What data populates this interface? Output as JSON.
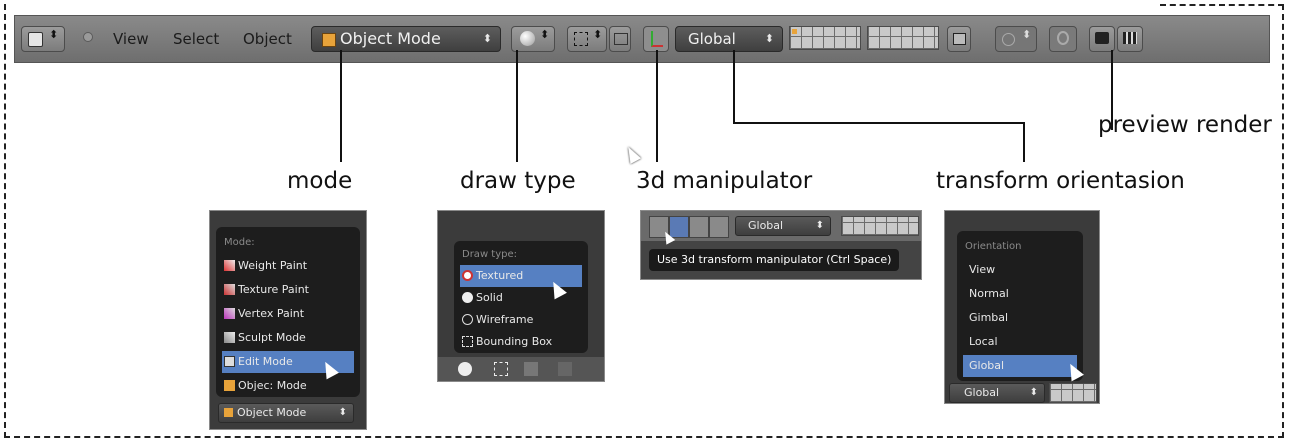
{
  "toolbar": {
    "menus": [
      "View",
      "Select",
      "Object"
    ],
    "mode_select": "Object Mode",
    "orientation_select": "Global"
  },
  "callouts": {
    "mode": "mode",
    "draw_type": "draw type",
    "manipulator": "3d manipulator",
    "orientation": "transform orientasion",
    "preview": "preview render"
  },
  "mode_menu": {
    "header": "Mode:",
    "items": [
      "Weight Paint",
      "Texture Paint",
      "Vertex Paint",
      "Sculpt Mode",
      "Edit Mode",
      "Objec: Mode"
    ],
    "selected_index": 4,
    "current": "Object Mode"
  },
  "draw_menu": {
    "header": "Draw type:",
    "items": [
      "Textured",
      "Solid",
      "Wireframe",
      "Bounding Box"
    ],
    "selected_index": 0
  },
  "manipulator_panel": {
    "select_value": "Global",
    "tooltip": "Use 3d transform manipulator (Ctrl Space)"
  },
  "orientation_menu": {
    "header": "Orientation",
    "items": [
      "View",
      "Normal",
      "Gimbal",
      "Local",
      "Global"
    ],
    "selected_index": 4,
    "current": "Global"
  },
  "colors": {
    "toolbar": "#7b7b7b",
    "menu_bg": "#1d1d1d",
    "selection": "#5680c2",
    "mode_cube": "#e8a33a"
  }
}
